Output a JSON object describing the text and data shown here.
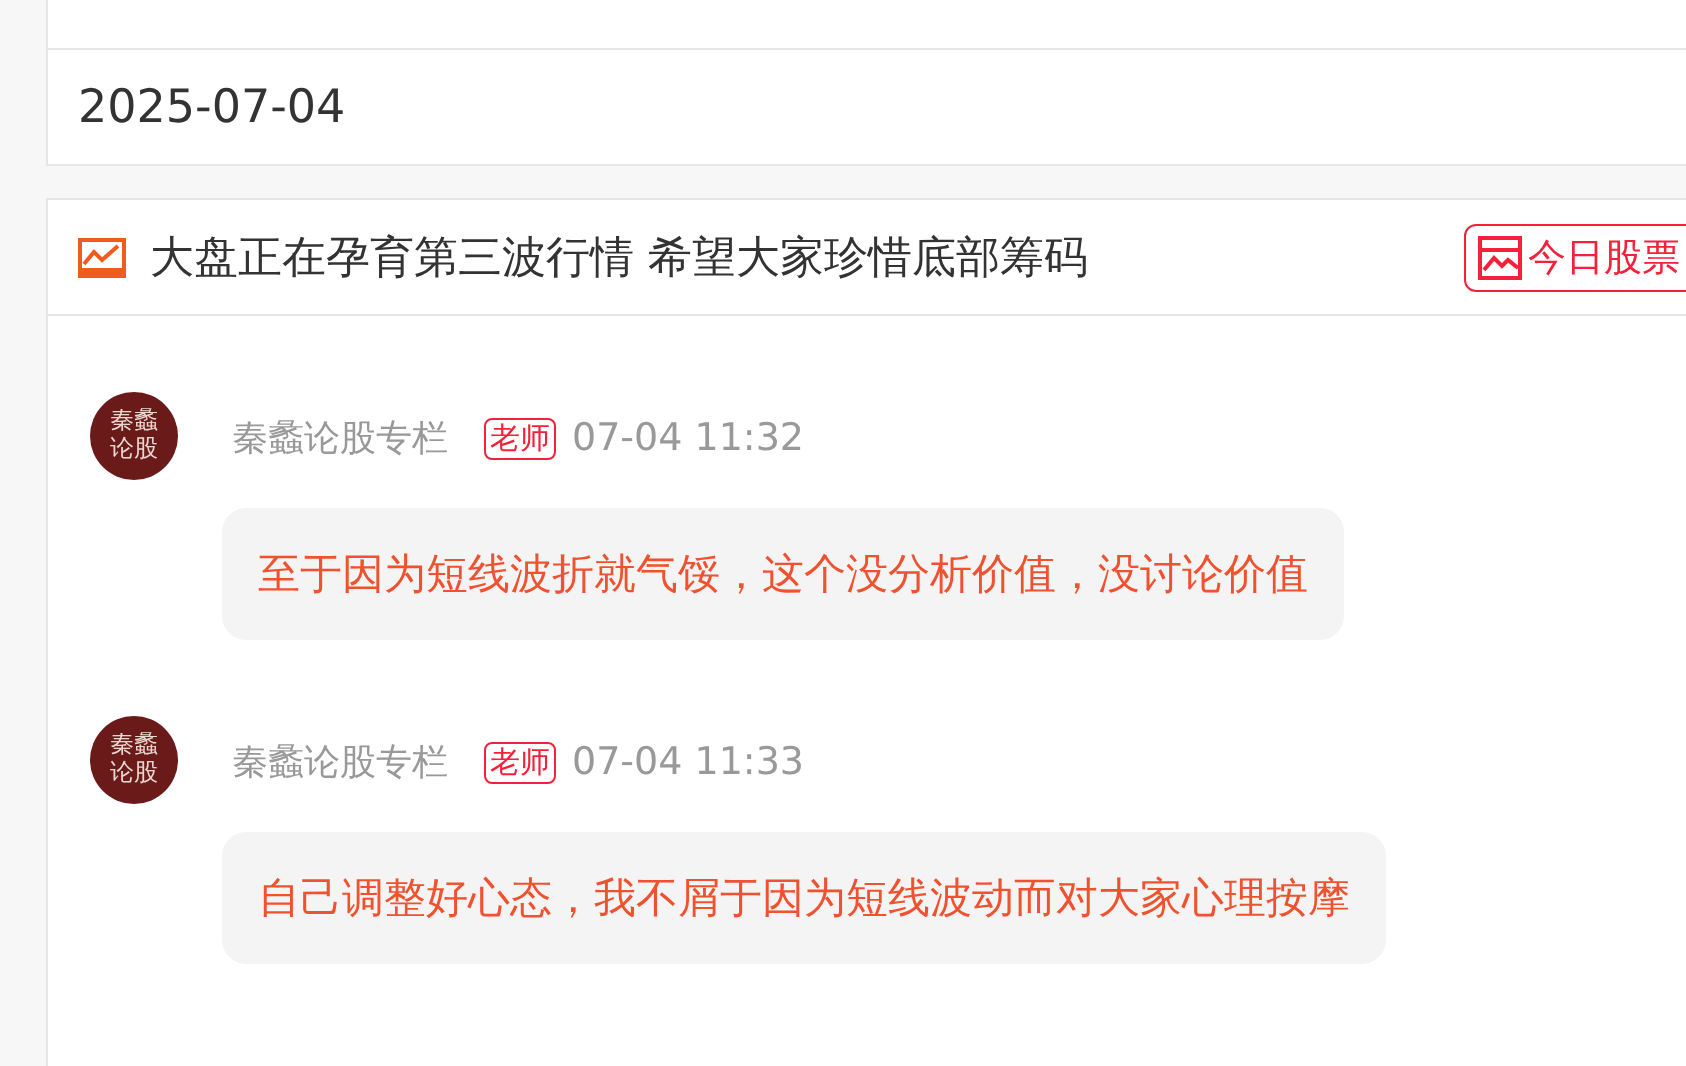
{
  "date": "2025-07-04",
  "topic": {
    "title": "大盘正在孕育第三波行情 希望大家珍惜底部筹码",
    "badge": "今日股票"
  },
  "messages": [
    {
      "avatar_lines": [
        "秦蠡",
        "论股"
      ],
      "author": "秦蠡论股专栏",
      "role": "老师",
      "time": "07-04 11:32",
      "text": "至于因为短线波折就气馁，这个没分析价值，没讨论价值"
    },
    {
      "avatar_lines": [
        "秦蠡",
        "论股"
      ],
      "author": "秦蠡论股专栏",
      "role": "老师",
      "time": "07-04 11:33",
      "text": "自己调整好心态，我不屑于因为短线波动而对大家心理按摩"
    }
  ]
}
